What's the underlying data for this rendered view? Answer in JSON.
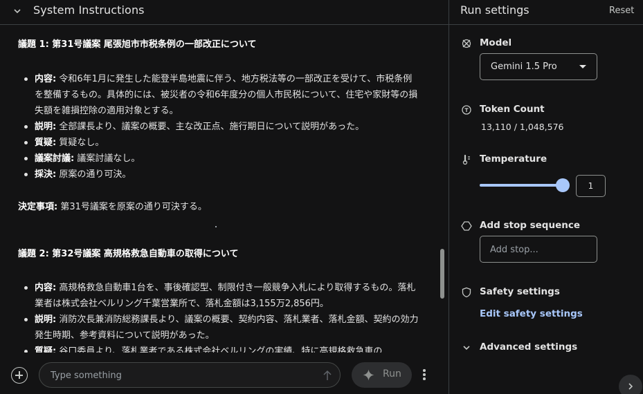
{
  "system_instructions": {
    "title": "System Instructions",
    "agenda1": {
      "heading": "議題 1: 第31号議案 尾張旭市市税条例の一部改正について",
      "items": [
        {
          "label": "内容:",
          "text": " 令和6年1月に発生した能登半島地震に伴う、地方税法等の一部改正を受けて、市税条例を整備するもの。具体的には、被災者の令和6年度分の個人市民税について、住宅や家財等の損失額を雑損控除の適用対象とする。"
        },
        {
          "label": "説明:",
          "text": " 全部課長より、議案の概要、主な改正点、施行期日について説明があった。"
        },
        {
          "label": "質疑:",
          "text": " 質疑なし。"
        },
        {
          "label": "議案討議:",
          "text": " 議案討議なし。"
        },
        {
          "label": "採決:",
          "text": " 原案の通り可決。"
        }
      ]
    },
    "decision": {
      "label": "決定事項:",
      "text": " 第31号議案を原案の通り可決する。"
    },
    "agenda2": {
      "heading": "議題 2: 第32号議案 高規格救急自動車の取得について",
      "items": [
        {
          "label": "内容:",
          "text": " 高規格救急自動車1台を、事後確認型、制限付き一般競争入札により取得するもの。落札業者は株式会社ベルリング千葉営業所で、落札金額は3,155万2,856円。"
        },
        {
          "label": "説明:",
          "text": " 消防次長兼消防総務課長より、議案の概要、契約内容、落札業者、落札金額、契約の効力発生時期、参考資料について説明があった。"
        },
        {
          "label": "質疑:",
          "text": " 谷口委員より、落札業者である株式会社ベルリングの実績、特に高規格救急車の"
        }
      ]
    }
  },
  "composer": {
    "placeholder": "Type something",
    "run_label": "Run"
  },
  "run_settings": {
    "title": "Run settings",
    "reset_label": "Reset",
    "model": {
      "label": "Model",
      "value": "Gemini 1.5 Pro"
    },
    "token_count": {
      "label": "Token Count",
      "value": "13,110 / 1,048,576"
    },
    "temperature": {
      "label": "Temperature",
      "value": "1",
      "fraction": 1.0
    },
    "stop_sequence": {
      "label": "Add stop sequence",
      "placeholder": "Add stop..."
    },
    "safety": {
      "label": "Safety settings",
      "link": "Edit safety settings"
    },
    "advanced": {
      "label": "Advanced settings"
    }
  },
  "colors": {
    "background": "#131314",
    "accent": "#a8c7fa",
    "border": "#3c4043"
  }
}
